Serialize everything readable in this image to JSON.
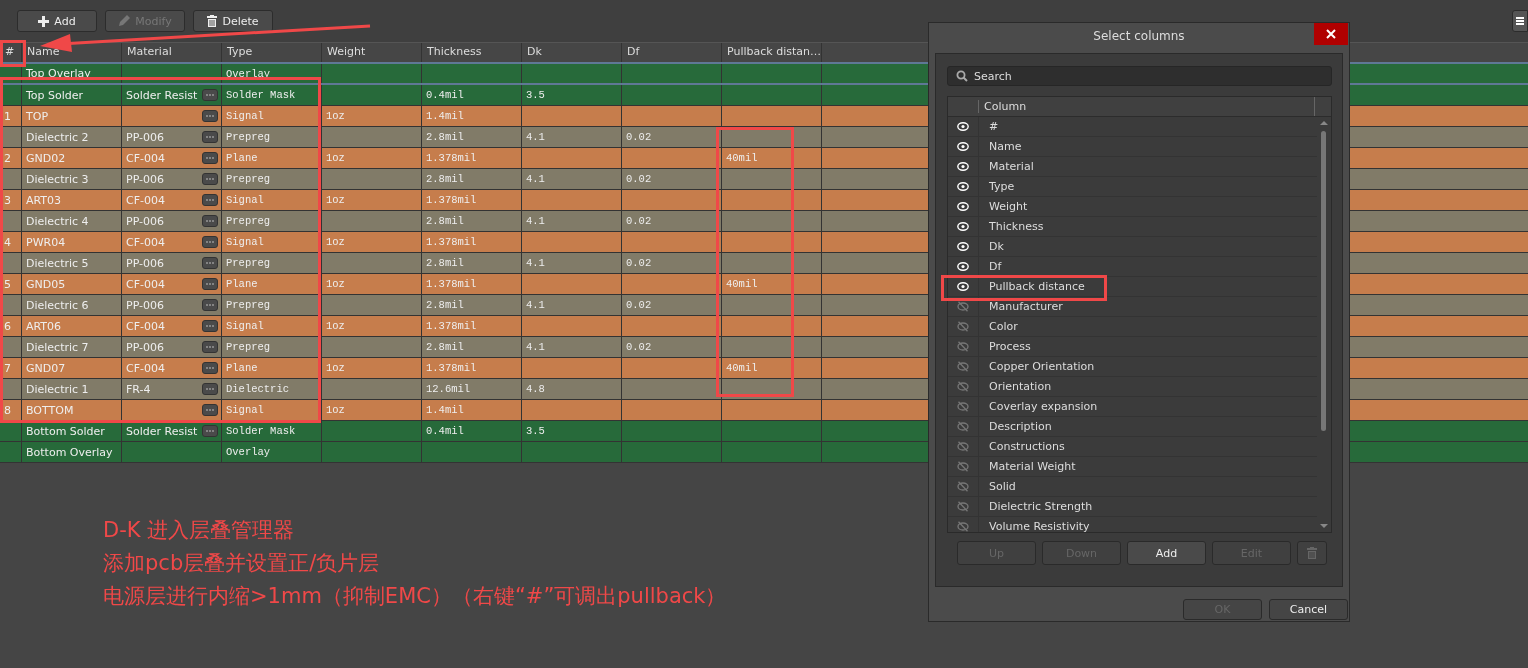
{
  "toolbar": {
    "buttons": [
      {
        "label": "Add",
        "disabled": false
      },
      {
        "label": "Modify",
        "disabled": true
      },
      {
        "label": "Delete",
        "disabled": false
      }
    ]
  },
  "table": {
    "columns": [
      "#",
      "Name",
      "Material",
      "Type",
      "Weight",
      "Thickness",
      "Dk",
      "Df",
      "Pullback distan…"
    ],
    "rows": [
      {
        "kind": "overlay",
        "name": "Top Overlay",
        "type": "Overlay"
      },
      {
        "kind": "mask",
        "name": "Top Solder",
        "material": "Solder Resist",
        "type": "Solder Mask",
        "thickness": "0.4mil",
        "dk": "3.5"
      },
      {
        "kind": "copper",
        "number": "1",
        "name": "TOP",
        "type": "Signal",
        "weight": "1oz",
        "thickness": "1.4mil"
      },
      {
        "kind": "dielectric",
        "name": "Dielectric 2",
        "material": "PP-006",
        "type": "Prepreg",
        "thickness": "2.8mil",
        "dk": "4.1",
        "df": "0.02"
      },
      {
        "kind": "copper",
        "number": "2",
        "name": "GND02",
        "material": "CF-004",
        "type": "Plane",
        "weight": "1oz",
        "thickness": "1.378mil",
        "pullback": "40mil"
      },
      {
        "kind": "dielectric",
        "name": "Dielectric 3",
        "material": "PP-006",
        "type": "Prepreg",
        "thickness": "2.8mil",
        "dk": "4.1",
        "df": "0.02"
      },
      {
        "kind": "copper",
        "number": "3",
        "name": "ART03",
        "material": "CF-004",
        "type": "Signal",
        "weight": "1oz",
        "thickness": "1.378mil"
      },
      {
        "kind": "dielectric",
        "name": "Dielectric 4",
        "material": "PP-006",
        "type": "Prepreg",
        "thickness": "2.8mil",
        "dk": "4.1",
        "df": "0.02"
      },
      {
        "kind": "copper",
        "number": "4",
        "name": "PWR04",
        "material": "CF-004",
        "type": "Signal",
        "weight": "1oz",
        "thickness": "1.378mil"
      },
      {
        "kind": "dielectric",
        "name": "Dielectric 5",
        "material": "PP-006",
        "type": "Prepreg",
        "thickness": "2.8mil",
        "dk": "4.1",
        "df": "0.02"
      },
      {
        "kind": "copper",
        "number": "5",
        "name": "GND05",
        "material": "CF-004",
        "type": "Plane",
        "weight": "1oz",
        "thickness": "1.378mil",
        "pullback": "40mil"
      },
      {
        "kind": "dielectric",
        "name": "Dielectric 6",
        "material": "PP-006",
        "type": "Prepreg",
        "thickness": "2.8mil",
        "dk": "4.1",
        "df": "0.02"
      },
      {
        "kind": "copper",
        "number": "6",
        "name": "ART06",
        "material": "CF-004",
        "type": "Signal",
        "weight": "1oz",
        "thickness": "1.378mil"
      },
      {
        "kind": "dielectric",
        "name": "Dielectric 7",
        "material": "PP-006",
        "type": "Prepreg",
        "thickness": "2.8mil",
        "dk": "4.1",
        "df": "0.02"
      },
      {
        "kind": "copper",
        "number": "7",
        "name": "GND07",
        "material": "CF-004",
        "type": "Plane",
        "weight": "1oz",
        "thickness": "1.378mil",
        "pullback": "40mil"
      },
      {
        "kind": "dielectric",
        "name": "Dielectric 1",
        "material": "FR-4",
        "type": "Dielectric",
        "thickness": "12.6mil",
        "dk": "4.8"
      },
      {
        "kind": "copper",
        "number": "8",
        "name": "BOTTOM",
        "type": "Signal",
        "weight": "1oz",
        "thickness": "1.4mil"
      },
      {
        "kind": "mask",
        "name": "Bottom Solder",
        "material": "Solder Resist",
        "type": "Solder Mask",
        "thickness": "0.4mil",
        "dk": "3.5"
      },
      {
        "kind": "overlay",
        "name": "Bottom Overlay",
        "type": "Overlay"
      }
    ]
  },
  "annotations": [
    "D-K 进入层叠管理器",
    "添加pcb层叠并设置正/负片层",
    "电源层进行内缩>1mm（抑制EMC）（右键“#”可调出pullback）"
  ],
  "dialog": {
    "title": "Select columns",
    "search": {
      "placeholder": "Search"
    },
    "list_header": "Column",
    "items": [
      {
        "label": "#",
        "visible": true
      },
      {
        "label": "Name",
        "visible": true
      },
      {
        "label": "Material",
        "visible": true
      },
      {
        "label": "Type",
        "visible": true
      },
      {
        "label": "Weight",
        "visible": true
      },
      {
        "label": "Thickness",
        "visible": true
      },
      {
        "label": "Dk",
        "visible": true
      },
      {
        "label": "Df",
        "visible": true
      },
      {
        "label": "Pullback distance",
        "visible": true
      },
      {
        "label": "Manufacturer",
        "visible": false
      },
      {
        "label": "Color",
        "visible": false
      },
      {
        "label": "Process",
        "visible": false
      },
      {
        "label": "Copper Orientation",
        "visible": false
      },
      {
        "label": "Orientation",
        "visible": false
      },
      {
        "label": "Coverlay expansion",
        "visible": false
      },
      {
        "label": "Description",
        "visible": false
      },
      {
        "label": "Constructions",
        "visible": false
      },
      {
        "label": "Material Weight",
        "visible": false
      },
      {
        "label": "Solid",
        "visible": false
      },
      {
        "label": "Dielectric Strength",
        "visible": false
      },
      {
        "label": "Volume Resistivity",
        "visible": false
      }
    ],
    "list_buttons": [
      {
        "kind": "text",
        "label": "Up",
        "disabled": true
      },
      {
        "kind": "text",
        "label": "Down",
        "disabled": true
      },
      {
        "kind": "text",
        "label": "Add",
        "disabled": false
      },
      {
        "kind": "text",
        "label": "Edit",
        "disabled": true
      },
      {
        "kind": "trash",
        "disabled": true
      }
    ],
    "footer_buttons": [
      {
        "label": "OK",
        "disabled": true
      },
      {
        "label": "Cancel",
        "disabled": false
      }
    ]
  }
}
